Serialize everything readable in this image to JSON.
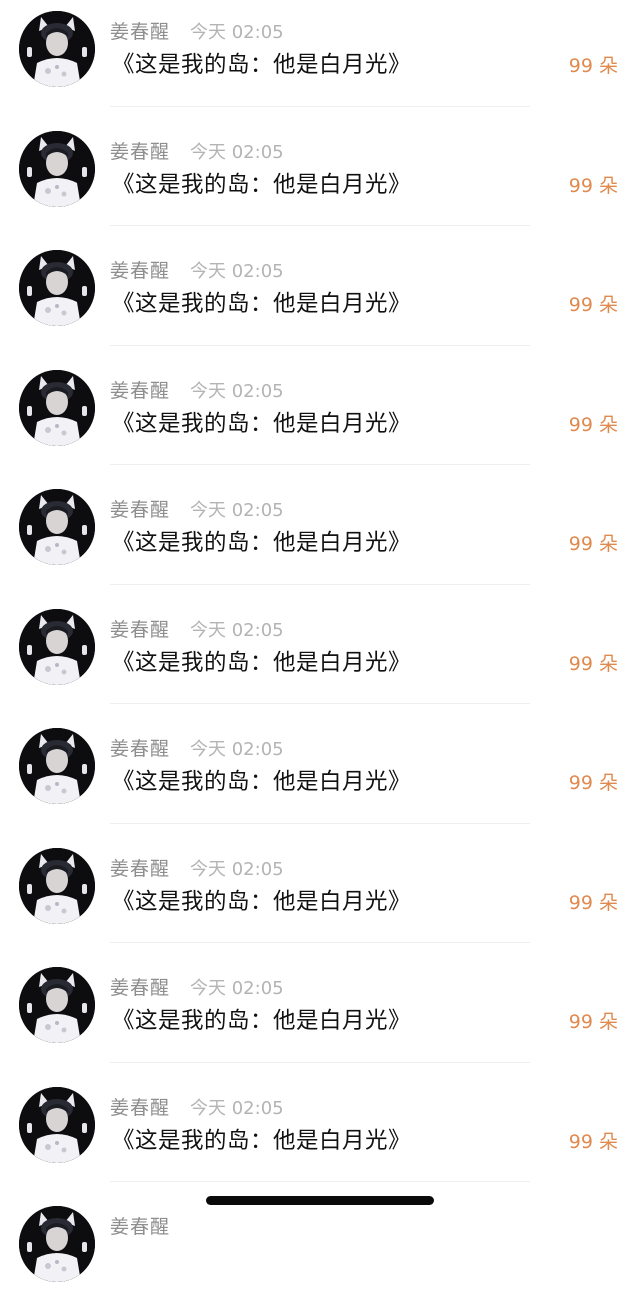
{
  "list": {
    "items": [
      {
        "name": "姜春醒",
        "time": "今天 02:05",
        "title": "《这是我的岛：他是白月光》",
        "count": "99 朵"
      },
      {
        "name": "姜春醒",
        "time": "今天 02:05",
        "title": "《这是我的岛：他是白月光》",
        "count": "99 朵"
      },
      {
        "name": "姜春醒",
        "time": "今天 02:05",
        "title": "《这是我的岛：他是白月光》",
        "count": "99 朵"
      },
      {
        "name": "姜春醒",
        "time": "今天 02:05",
        "title": "《这是我的岛：他是白月光》",
        "count": "99 朵"
      },
      {
        "name": "姜春醒",
        "time": "今天 02:05",
        "title": "《这是我的岛：他是白月光》",
        "count": "99 朵"
      },
      {
        "name": "姜春醒",
        "time": "今天 02:05",
        "title": "《这是我的岛：他是白月光》",
        "count": "99 朵"
      },
      {
        "name": "姜春醒",
        "time": "今天 02:05",
        "title": "《这是我的岛：他是白月光》",
        "count": "99 朵"
      },
      {
        "name": "姜春醒",
        "time": "今天 02:05",
        "title": "《这是我的岛：他是白月光》",
        "count": "99 朵"
      },
      {
        "name": "姜春醒",
        "time": "今天 02:05",
        "title": "《这是我的岛：他是白月光》",
        "count": "99 朵"
      },
      {
        "name": "姜春醒",
        "time": "今天 02:05",
        "title": "《这是我的岛：他是白月光》",
        "count": "99 朵"
      },
      {
        "name": "姜春醒",
        "time": "",
        "title": "",
        "count": ""
      }
    ]
  },
  "colors": {
    "name": "#8e8e8e",
    "time": "#b4b4b4",
    "title": "#111111",
    "count": "#e08a4f",
    "divider": "#efefef",
    "home_indicator": "#0a0a0a"
  },
  "icons": {
    "avatar": "user-avatar-photo"
  }
}
